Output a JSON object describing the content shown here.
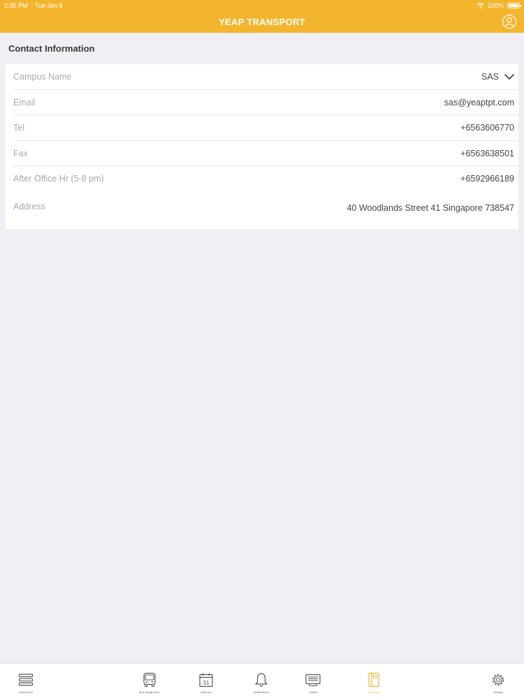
{
  "status_bar": {
    "time": "2:35 PM",
    "date": "Tue Jan 8",
    "battery": "100%"
  },
  "header": {
    "title": "YEAP TRANSPORT"
  },
  "section": {
    "title": "Contact Information"
  },
  "rows": [
    {
      "label": "Campus Name",
      "value": "SAS"
    },
    {
      "label": "Email",
      "value": "sas@yeaptpt.com"
    },
    {
      "label": "Tel",
      "value": "+6563606770"
    },
    {
      "label": "Fax",
      "value": "+6563638501"
    },
    {
      "label": "After Office Hr (5-8 pm)",
      "value": "+6592966189"
    },
    {
      "label": "Address",
      "value": "40 Woodlands Street 41 Singapore 738547"
    }
  ],
  "tabs": [
    {
      "label": "Dashboard",
      "icon": "menu-icon"
    },
    {
      "label": "Bus Assignment",
      "icon": "bus-icon"
    },
    {
      "label": "Absence",
      "icon": "calendar-icon",
      "day": "31"
    },
    {
      "label": "Notifications",
      "icon": "bell-icon"
    },
    {
      "label": "Tickets",
      "icon": "ticket-icon"
    },
    {
      "label": "Contacts",
      "icon": "contacts-book-icon",
      "active": true
    },
    {
      "label": "Settings",
      "icon": "gear-icon"
    }
  ],
  "colors": {
    "accent": "#f4b52e",
    "background": "#efeff4",
    "label": "#a9a9ae"
  }
}
